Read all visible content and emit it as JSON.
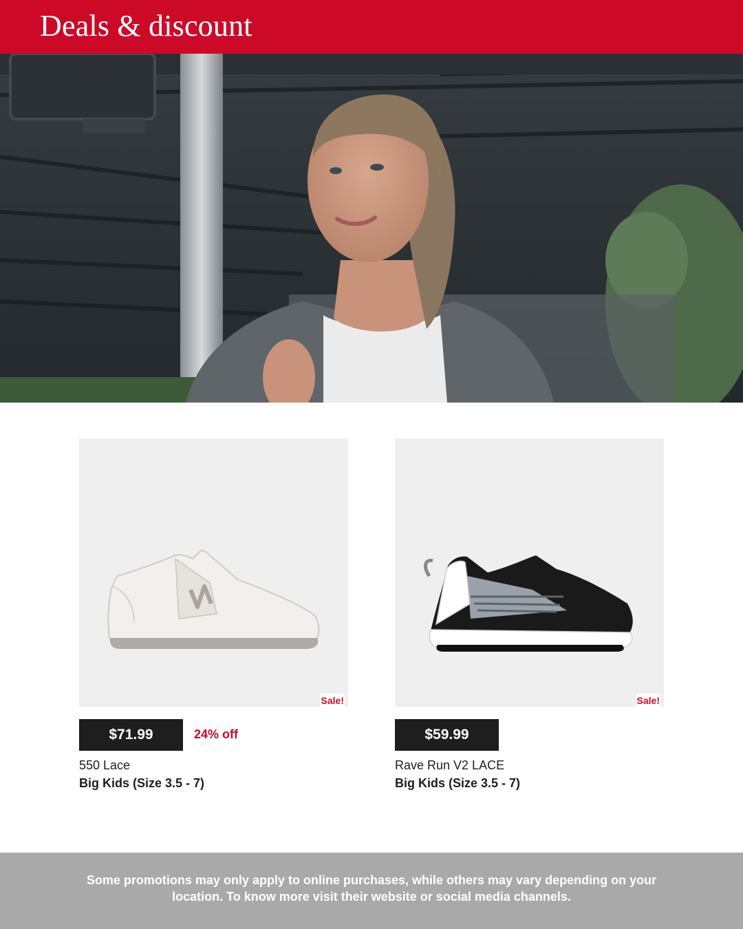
{
  "header": {
    "title": "Deals & discount"
  },
  "hero": {
    "icon": "hero-photo"
  },
  "products": [
    {
      "price": "$71.99",
      "discount": "24% off",
      "name": "550 Lace",
      "size": "Big Kids (Size 3.5 - 7)",
      "badge": "Sale!",
      "icon": "white-sneaker-image"
    },
    {
      "price": "$59.99",
      "discount": "",
      "name": "Rave Run V2 LACE",
      "size": "Big Kids (Size 3.5 - 7)",
      "badge": "Sale!",
      "icon": "black-sneaker-image"
    }
  ],
  "footer": {
    "text": "Some promotions may only apply to online purchases, while others may vary depending on your location. To know more visit their website or social media channels."
  },
  "colors": {
    "brand_red": "#cc0a28",
    "price_box": "#1e1e1e",
    "footer_gray": "#a9a9a9",
    "image_bg": "#efefef"
  }
}
